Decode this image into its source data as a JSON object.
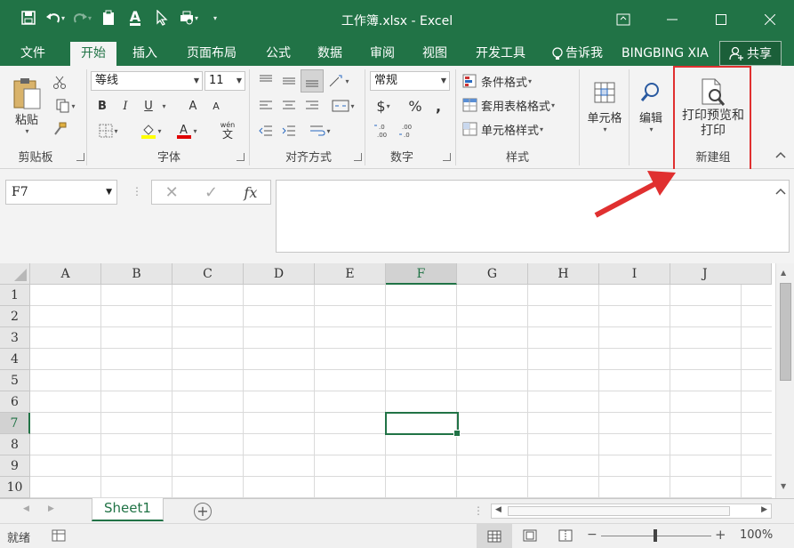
{
  "window": {
    "title": "工作簿.xlsx - Excel"
  },
  "tabs": [
    {
      "label": "文件"
    },
    {
      "label": "开始"
    },
    {
      "label": "插入"
    },
    {
      "label": "页面布局"
    },
    {
      "label": "公式"
    },
    {
      "label": "数据"
    },
    {
      "label": "审阅"
    },
    {
      "label": "视图"
    },
    {
      "label": "开发工具"
    }
  ],
  "active_tab": "开始",
  "tell_me": "告诉我",
  "user": "BINGBING XIA",
  "share_label": "共享",
  "ribbon": {
    "clipboard": {
      "paste": "粘贴",
      "label": "剪贴板"
    },
    "font": {
      "name": "等线",
      "size": "11",
      "label": "字体",
      "wen": "wén",
      "bold": "B",
      "italic": "I",
      "underline": "U",
      "grow": "A",
      "shrink": "A"
    },
    "alignment": {
      "label": "对齐方式"
    },
    "number": {
      "format": "常规",
      "label": "数字",
      "currency": "$",
      "percent": "%",
      "comma": ","
    },
    "styles": {
      "conditional": "条件格式",
      "table": "套用表格格式",
      "cell_styles": "单元格样式",
      "label": "样式"
    },
    "cells": {
      "label": "单元格"
    },
    "editing": {
      "label": "编辑"
    },
    "custom": {
      "print_preview_line1": "打印预览和",
      "print_preview_line2": "打印",
      "label": "新建组"
    }
  },
  "formula_bar": {
    "name_box": "F7",
    "formula": "",
    "fx": "fx"
  },
  "grid": {
    "columns": [
      "A",
      "B",
      "C",
      "D",
      "E",
      "F",
      "G",
      "H",
      "I",
      "J"
    ],
    "rows": [
      "1",
      "2",
      "3",
      "4",
      "5",
      "6",
      "7",
      "8",
      "9",
      "10"
    ],
    "selected_column": "F",
    "selected_row": "7"
  },
  "sheets": [
    {
      "name": "Sheet1"
    }
  ],
  "status": {
    "mode": "就绪",
    "zoom": "100%"
  },
  "colors": {
    "accent": "#217346",
    "annotation": "#e03030"
  }
}
